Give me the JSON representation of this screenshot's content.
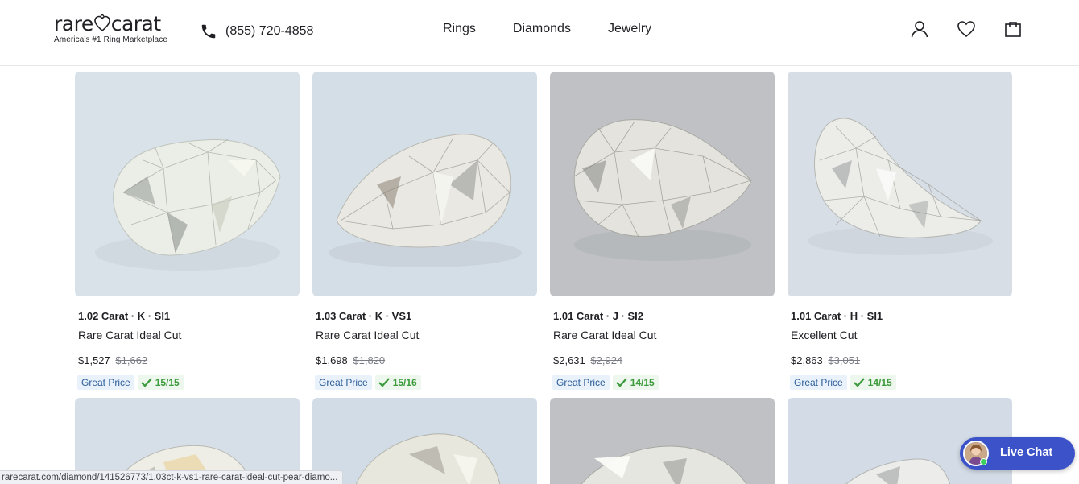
{
  "header": {
    "logo_left": "rare",
    "logo_right": "carat",
    "logo_tagline": "America's #1 Ring Marketplace",
    "phone": "(855) 720-4858",
    "nav": [
      "Rings",
      "Diamonds",
      "Jewelry"
    ],
    "icons": [
      "user-icon",
      "heart-icon",
      "bag-icon"
    ]
  },
  "products": [
    {
      "title": "1.02 Carat · K · SI1",
      "cut": "Rare Carat Ideal Cut",
      "price": "$1,527",
      "old_price": "$1,662",
      "badge": "Great Price",
      "score": "15/15",
      "bg": "#d9e1e9"
    },
    {
      "title": "1.03 Carat · K · VS1",
      "cut": "Rare Carat Ideal Cut",
      "price": "$1,698",
      "old_price": "$1,820",
      "badge": "Great Price",
      "score": "15/16",
      "bg": "#d4dee7"
    },
    {
      "title": "1.01 Carat · J · SI2",
      "cut": "Rare Carat Ideal Cut",
      "price": "$2,631",
      "old_price": "$2,924",
      "badge": "Great Price",
      "score": "14/15",
      "bg": "#bfc1c4"
    },
    {
      "title": "1.01 Carat · H · SI1",
      "cut": "Excellent Cut",
      "price": "$2,863",
      "old_price": "$3,051",
      "badge": "Great Price",
      "score": "14/15",
      "bg": "#d8dee6"
    }
  ],
  "statusbar": "rarecarat.com/diamond/141526773/1.03ct-k-vs1-rare-carat-ideal-cut-pear-diamo...",
  "livechat": "Live Chat",
  "colors": {
    "accent": "#3c52c9",
    "great_price_bg": "#e9f1fb",
    "score_green": "#3b9a3b"
  }
}
